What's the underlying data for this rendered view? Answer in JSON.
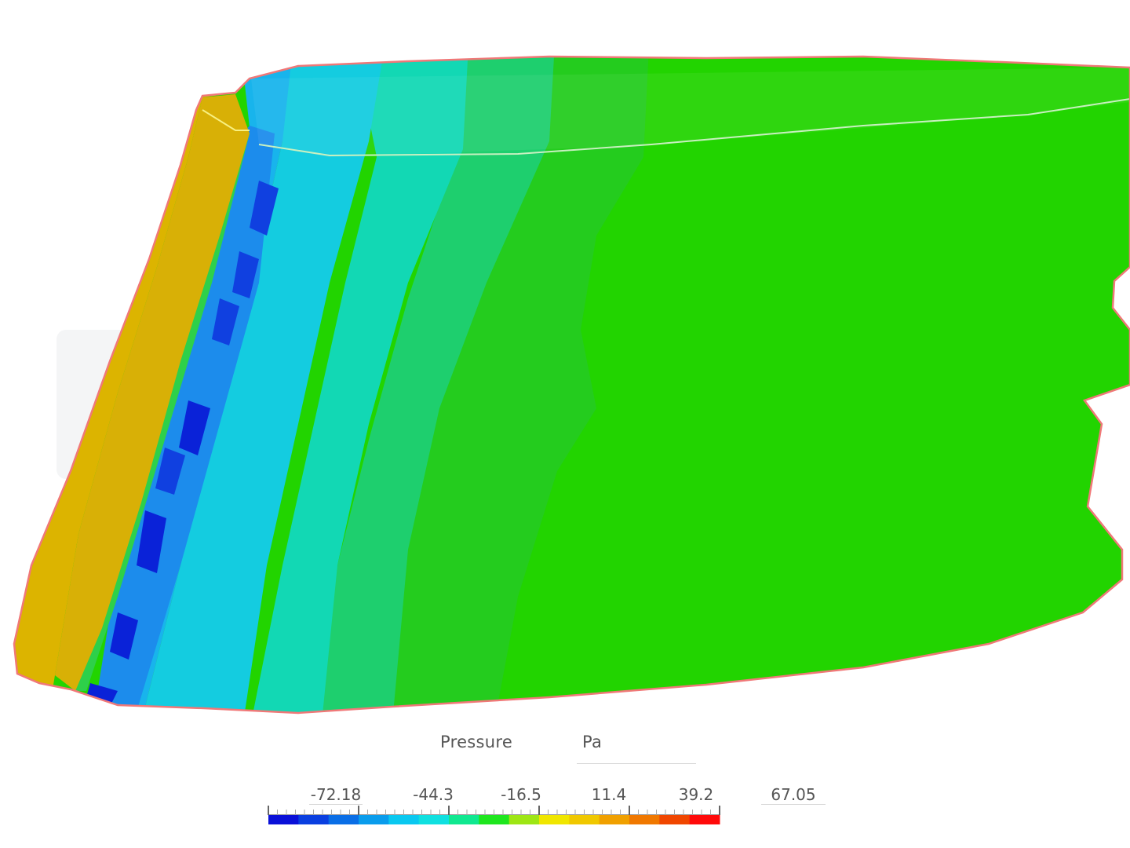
{
  "legend": {
    "quantity": "Pressure",
    "unit": "Pa",
    "ticks": [
      "-72.18",
      "-44.3",
      "-16.5",
      "11.4",
      "39.2"
    ],
    "tick_values": [
      -72.18,
      -44.3,
      -16.5,
      11.4,
      39.2
    ],
    "max_value": "67.05",
    "range": [
      -72.18,
      67.05
    ],
    "colormap": [
      "#0a10d8",
      "#0a3fe0",
      "#0a6ee6",
      "#0a9cec",
      "#0ac8f0",
      "#10e0e0",
      "#10e890",
      "#1ee61e",
      "#9ee614",
      "#f0e600",
      "#f0c800",
      "#f0a000",
      "#f07800",
      "#f04600",
      "#ff0a0a"
    ]
  },
  "model": {
    "name": "pressure-contour-surface",
    "edge_color": "#f07878"
  }
}
